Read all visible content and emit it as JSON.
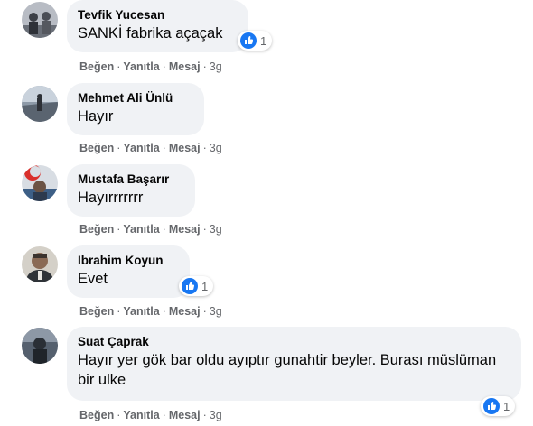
{
  "actions": {
    "like": "Beğen",
    "reply": "Yanıtla",
    "message": "Mesaj",
    "separator": "·"
  },
  "comments": [
    {
      "author": "Tevfik Yucesan",
      "text": "SANKİ fabrika açaçak",
      "time": "3g",
      "reactions": "1"
    },
    {
      "author": "Mehmet Ali Ünlü",
      "text": "Hayır",
      "time": "3g"
    },
    {
      "author": "Mustafa Başarır",
      "text": "Hayırrrrrrr",
      "time": "3g"
    },
    {
      "author": "Ibrahim Koyun",
      "text": "Evet",
      "time": "3g",
      "reactions": "1"
    },
    {
      "author": "Suat Çaprak",
      "text": "Hayır yer gök bar oldu ayıptır gunahtir beyler. Burası müslüman bir ulke",
      "time": "3g",
      "reactions": "1"
    }
  ],
  "colors": {
    "bubble": "#f0f2f5",
    "meta_text": "#65676b",
    "like_blue": "#1877f2"
  }
}
